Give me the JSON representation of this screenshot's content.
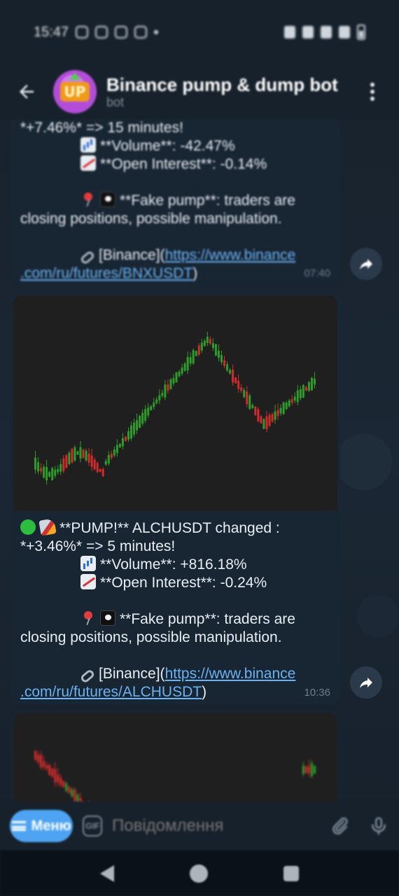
{
  "status_bar": {
    "time": "15:47"
  },
  "header": {
    "back_label": "←",
    "title": "Binance pump & dump bot",
    "subtitle": "bot",
    "avatar_text": "UP"
  },
  "messages": [
    {
      "lines": {
        "change_tail": "*+7.46%* => 15 minutes!",
        "volume": "**Volume**: -42.47%",
        "oi": "**Open Interest**: -0.14%",
        "fake": "**Fake pump**: traders are",
        "fake2": "closing positions, possible manipulation.",
        "link_prefix": "[Binance](",
        "link_url_1": "https://www.binance",
        "link_url_2": ".com/ru/futures/BNXUSDT",
        "link_suffix": ")"
      },
      "time": "07:40"
    },
    {
      "lines": {
        "headline": "**PUMP!** ALCHUSDT changed :",
        "change_tail": "*+3.46%* => 5 minutes!",
        "volume": "**Volume**: +816.18%",
        "oi": "**Open Interest**: -0.24%",
        "fake": "**Fake pump**: traders are",
        "fake2": "closing positions, possible manipulation.",
        "link_prefix": "[Binance](",
        "link_url_1": "https://www.binance",
        "link_url_2": ".com/ru/futures/ALCHUSDT",
        "link_suffix": ")"
      },
      "time": "10:36"
    }
  ],
  "input": {
    "menu_label": "Меню",
    "gif_label": "GIF",
    "placeholder": "Повідомлення"
  },
  "colors": {
    "background": "#0e1621",
    "bubble": "#182533",
    "link": "#6ab2f2",
    "accent": "#4ea4f2",
    "candle_up": "#2e9c2a",
    "candle_down": "#d22b2b"
  },
  "icons": {
    "back": "arrow-left-icon",
    "more": "more-vertical-icon",
    "forward": "share-forward-icon",
    "attach": "paperclip-icon",
    "mic": "microphone-icon"
  }
}
